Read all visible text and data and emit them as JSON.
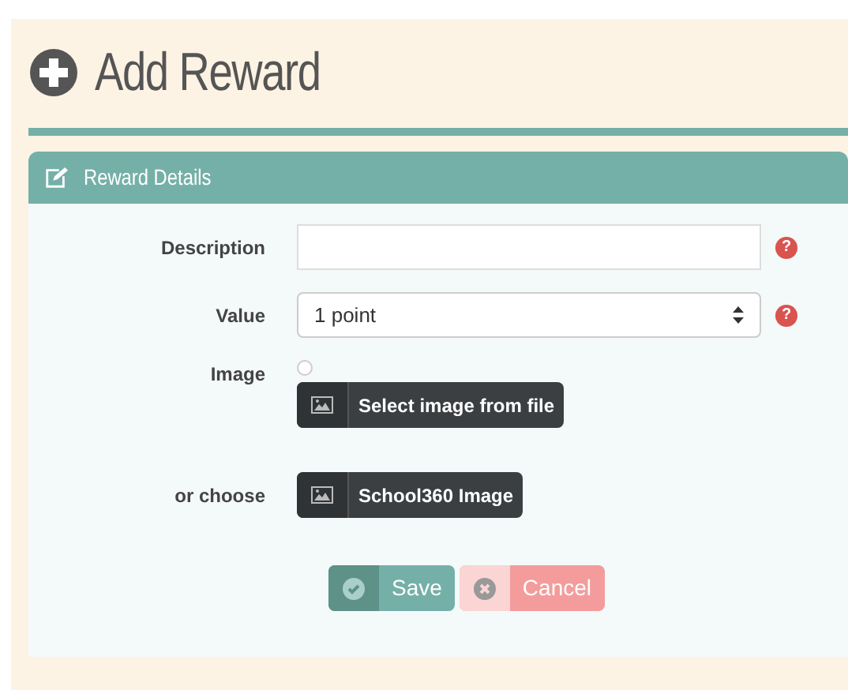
{
  "page": {
    "title": "Add Reward"
  },
  "panel": {
    "title": "Reward Details"
  },
  "fields": [
    {
      "kind": "text",
      "label": "Description",
      "help": "?"
    },
    {
      "kind": "select",
      "label": "Value",
      "value": "1 point",
      "help": "?"
    },
    {
      "kind": "image",
      "label": "Image",
      "checked": false,
      "button": "Select image from file"
    },
    {
      "kind": "choose",
      "label": "or choose",
      "button": "School360 Image"
    }
  ],
  "actions": [
    {
      "kind": "save",
      "label": "Save"
    },
    {
      "kind": "cancel",
      "label": "Cancel"
    }
  ]
}
